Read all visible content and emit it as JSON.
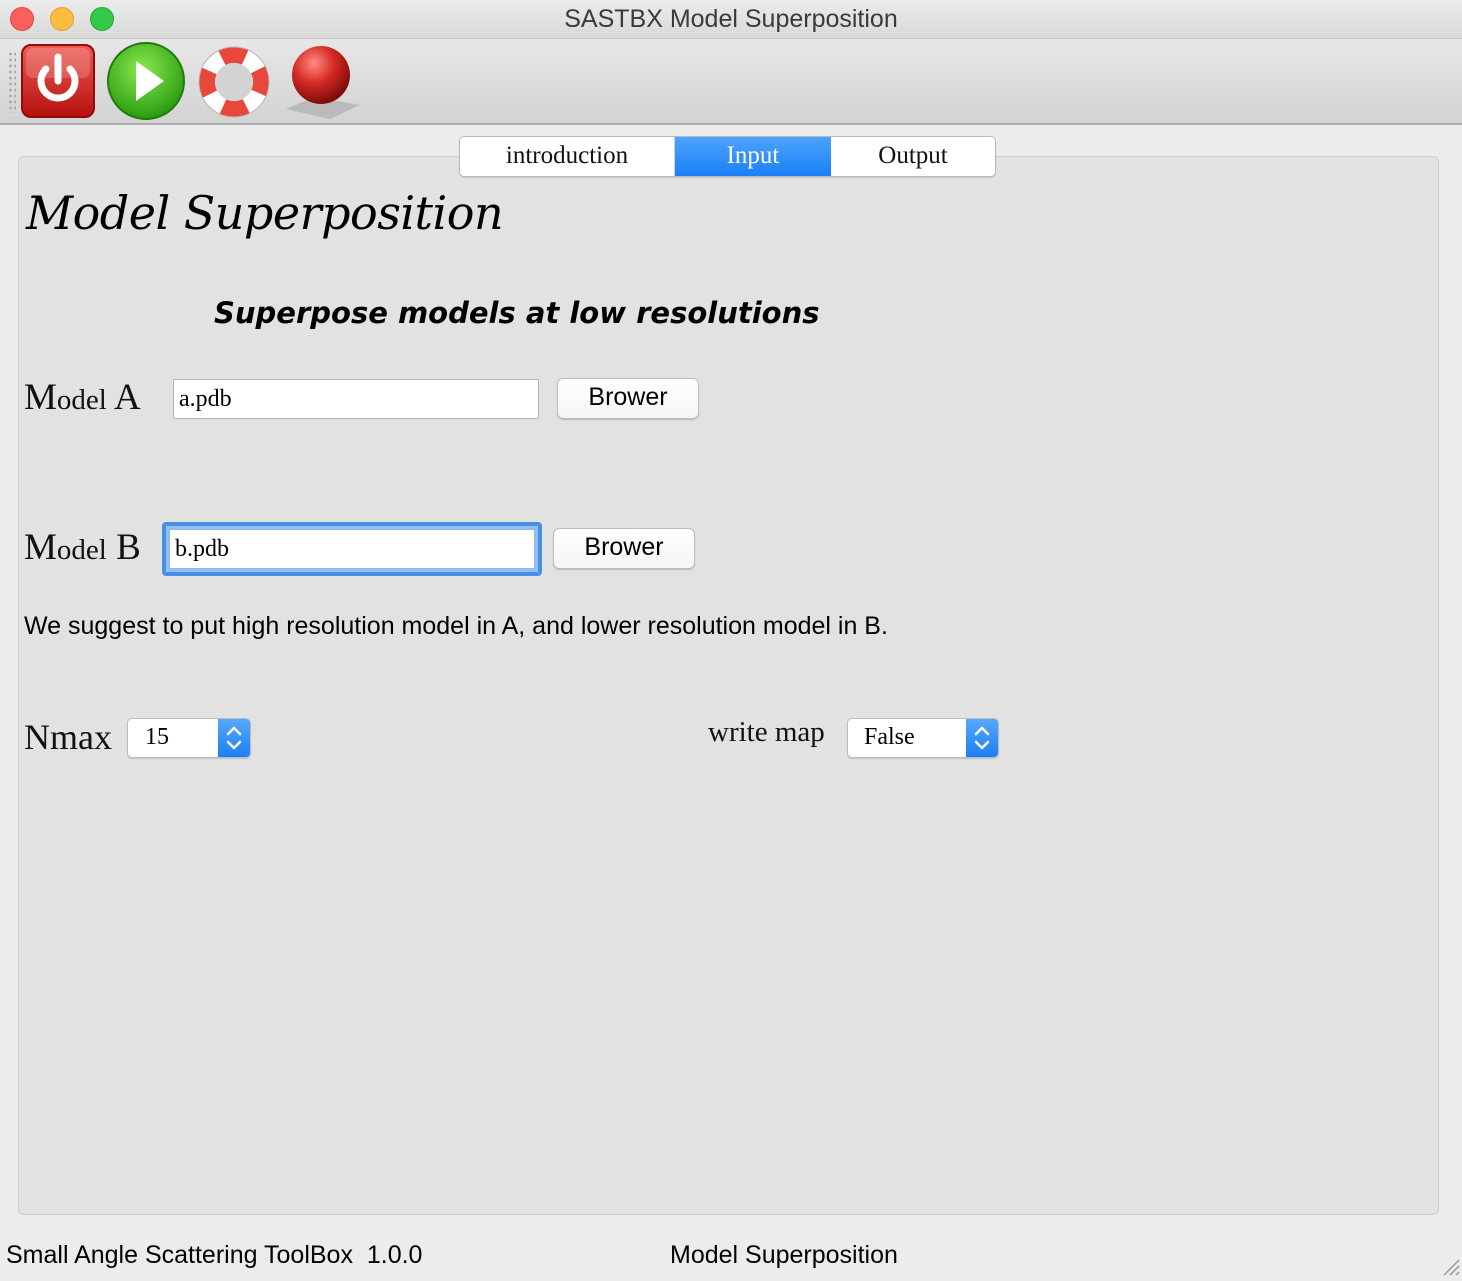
{
  "window": {
    "title": "SASTBX Model Superposition"
  },
  "toolbar": {
    "buttons": [
      {
        "name": "power-icon",
        "color": "#d9221f"
      },
      {
        "name": "play-icon",
        "color": "#3dbd1b"
      },
      {
        "name": "lifebuoy-icon",
        "color": "#e8473b"
      },
      {
        "name": "red-sphere-icon",
        "color": "#c81d1d"
      }
    ]
  },
  "tabs": [
    {
      "label": "introduction",
      "active": false
    },
    {
      "label": "Input",
      "active": true
    },
    {
      "label": "Output",
      "active": false
    }
  ],
  "main": {
    "heading": "Model Superposition",
    "subtitle": "Superpose models at low resolutions",
    "model_a": {
      "label_first": "M",
      "label_rest": "odel",
      "label_letter": " A",
      "value": "a.pdb",
      "browse_label": "Brower"
    },
    "model_b": {
      "label_first": "M",
      "label_rest": "odel",
      "label_letter": " B",
      "value": "b.pdb",
      "browse_label": "Brower"
    },
    "hint": "We suggest to put high resolution model in A, and lower resolution model in B.",
    "nmax": {
      "label": "Nmax",
      "value": "15"
    },
    "write_map": {
      "label": "write map",
      "value": "False"
    }
  },
  "status_bar": {
    "left": "Small Angle Scattering ToolBox  1.0.0",
    "right": "Model Superposition"
  },
  "colors": {
    "accent": "#1a80f5",
    "panel": "#e2e2e2",
    "window": "#ececec"
  }
}
